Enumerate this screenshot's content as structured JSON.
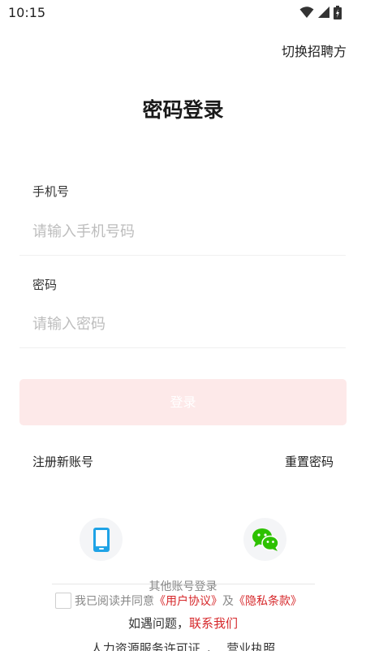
{
  "status_bar": {
    "time": "10:15",
    "icons": [
      "wifi-icon",
      "signal-icon",
      "battery-icon"
    ]
  },
  "header": {
    "switch_role_label": "切换招聘方"
  },
  "title": "密码登录",
  "form": {
    "phone_label": "手机号",
    "phone_placeholder": "请输入手机号码",
    "phone_value": "",
    "password_label": "密码",
    "password_placeholder": "请输入密码",
    "password_value": ""
  },
  "login_button_label": "登录",
  "links": {
    "register": "注册新账号",
    "reset_password": "重置密码"
  },
  "other_login": {
    "label": "其他账号登录",
    "methods": [
      "phone-icon",
      "wechat-icon"
    ]
  },
  "agreement": {
    "prefix": "我已阅读并同意",
    "user_agreement": "《用户协议》",
    "and": "及",
    "privacy": "《隐私条款》",
    "checked": false
  },
  "help": {
    "question": "如遇问题，",
    "contact": "联系我们"
  },
  "footer": {
    "license": "人力资源服务许可证",
    "business": "营业执照"
  },
  "colors": {
    "accent": "#d6282b",
    "login_button_bg": "#fde9e9",
    "wechat_green": "#2dc100",
    "phone_blue": "#1fa3e6"
  }
}
